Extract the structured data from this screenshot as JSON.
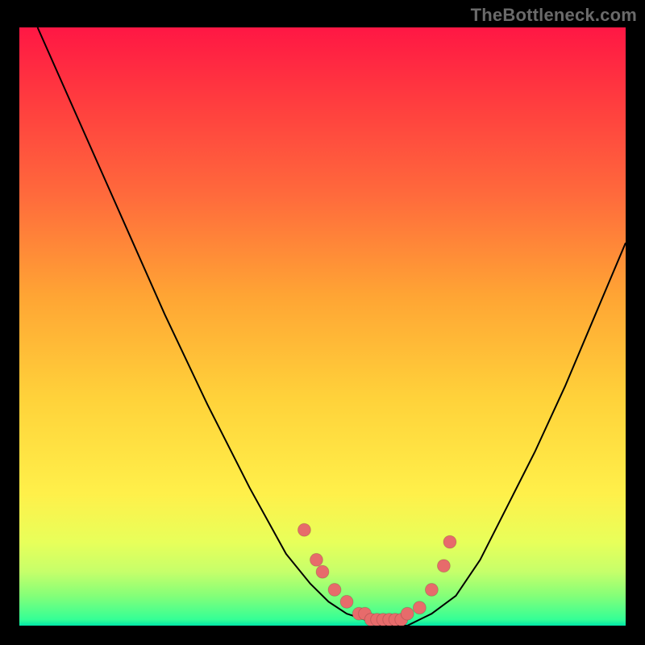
{
  "watermark": "TheBottleneck.com",
  "colors": {
    "background": "#000000",
    "frame_border": "#000000",
    "curve": "#000000",
    "dot": "#e76b6b",
    "gradient_stops": [
      {
        "pos": 0.0,
        "hex": "#ff1744"
      },
      {
        "pos": 0.12,
        "hex": "#ff3b3f"
      },
      {
        "pos": 0.28,
        "hex": "#ff6a3c"
      },
      {
        "pos": 0.45,
        "hex": "#ffa534"
      },
      {
        "pos": 0.62,
        "hex": "#ffd23a"
      },
      {
        "pos": 0.78,
        "hex": "#fff04a"
      },
      {
        "pos": 0.86,
        "hex": "#e8ff5a"
      },
      {
        "pos": 0.91,
        "hex": "#c6ff6a"
      },
      {
        "pos": 0.95,
        "hex": "#84ff78"
      },
      {
        "pos": 0.99,
        "hex": "#34ff96"
      },
      {
        "pos": 1.0,
        "hex": "#00e6a8"
      }
    ]
  },
  "chart_data": {
    "type": "line",
    "title": "",
    "xlabel": "",
    "ylabel": "",
    "xlim": [
      0,
      100
    ],
    "ylim": [
      0,
      100
    ],
    "grid": false,
    "legend": false,
    "series": [
      {
        "name": "curve",
        "x": [
          3,
          10,
          17,
          24,
          31,
          38,
          44,
          48,
          51,
          54,
          57,
          59,
          62,
          64,
          66,
          68,
          72,
          76,
          80,
          85,
          90,
          95,
          100
        ],
        "y": [
          100,
          84,
          68,
          52,
          37,
          23,
          12,
          7,
          4,
          2,
          1,
          0,
          0,
          0,
          1,
          2,
          5,
          11,
          19,
          29,
          40,
          52,
          64
        ]
      }
    ],
    "dots": {
      "name": "markers",
      "x": [
        47,
        49,
        50,
        52,
        54,
        56,
        57,
        58,
        59,
        60,
        61,
        62,
        63,
        64,
        66,
        68,
        70,
        71
      ],
      "y": [
        16,
        11,
        9,
        6,
        4,
        2,
        2,
        1,
        1,
        1,
        1,
        1,
        1,
        2,
        3,
        6,
        10,
        14
      ]
    }
  }
}
